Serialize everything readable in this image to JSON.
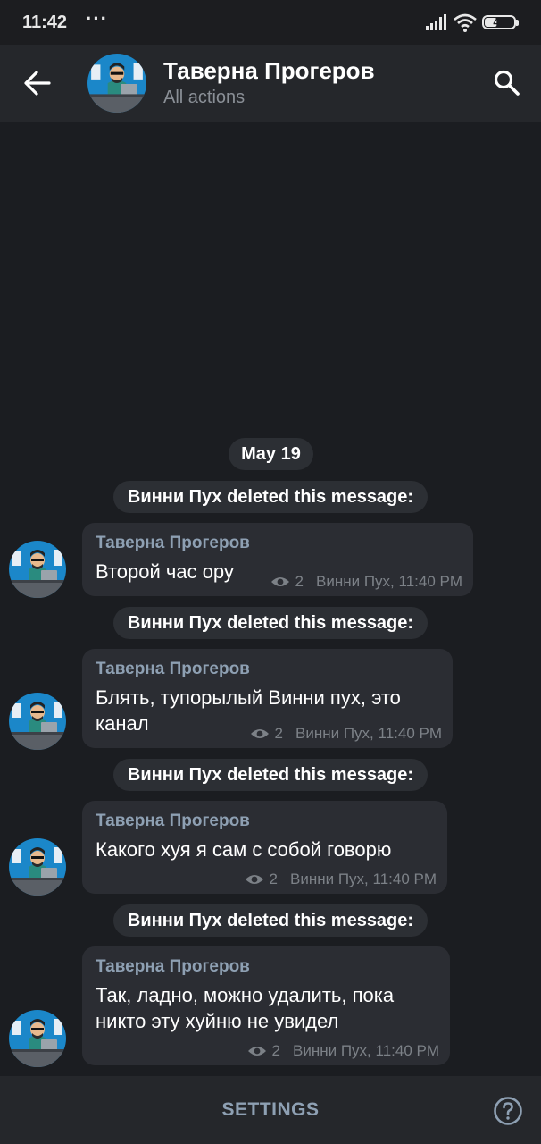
{
  "status_bar": {
    "time": "11:42",
    "dots": "···",
    "battery": "41",
    "icons": [
      "signal-icon",
      "wifi-icon",
      "battery-icon"
    ]
  },
  "header": {
    "title": "Таверна Прогеров",
    "subtitle": "All actions",
    "back_icon": "arrow-left-icon",
    "search_icon": "search-icon"
  },
  "date_separator": "May 19",
  "entries": [
    {
      "service": "Винни Пух deleted this message:",
      "author": "Таверна Прогеров",
      "text": "Второй час ору",
      "views": "2",
      "signature": "Винни Пух, 11:40 PM"
    },
    {
      "service": "Винни Пух deleted this message:",
      "author": "Таверна Прогеров",
      "text": "Блять, тупорылый Винни пух, это канал",
      "views": "2",
      "signature": "Винни Пух, 11:40 PM"
    },
    {
      "service": "Винни Пух deleted this message:",
      "author": "Таверна Прогеров",
      "text": "Какого хуя я сам с собой говорю",
      "views": "2",
      "signature": "Винни Пух, 11:40 PM"
    },
    {
      "service": "Винни Пух deleted this message:",
      "author": "Таверна Прогеров",
      "text": "Так, ладно, можно удалить, пока никто эту хуйню не увидел",
      "views": "2",
      "signature": "Винни Пух, 11:40 PM"
    }
  ],
  "bottom_bar": {
    "settings_label": "SETTINGS",
    "help_icon": "help-circle-icon"
  },
  "colors": {
    "background": "#1b1d21",
    "header": "#25272b",
    "bubble": "#2b2d33",
    "accent": "#8ea0b3",
    "avatar_blue": "#1b87c9"
  }
}
